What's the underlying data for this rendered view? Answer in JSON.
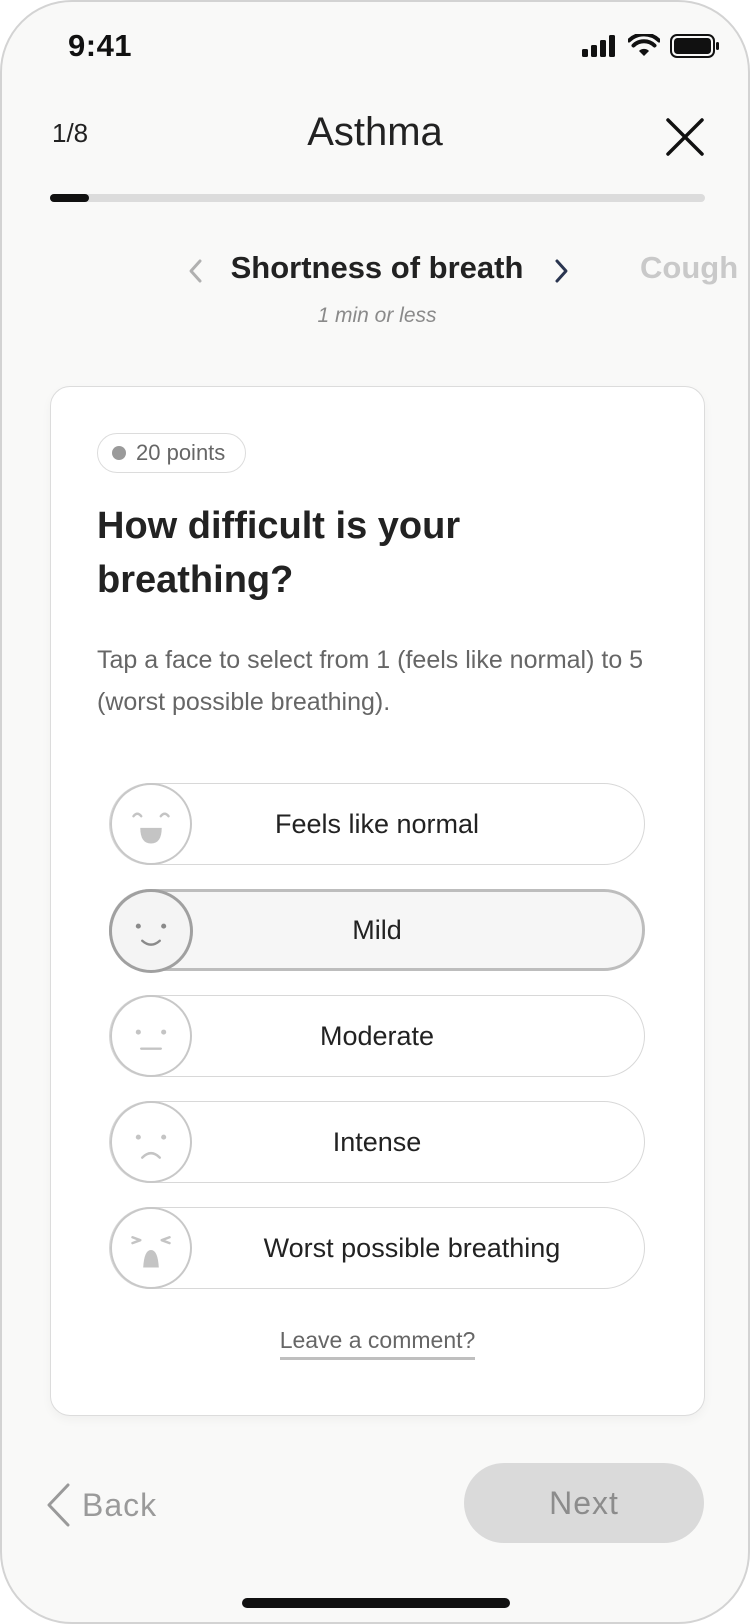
{
  "status_bar": {
    "time": "9:41"
  },
  "header": {
    "step": "1/8",
    "title": "Asthma"
  },
  "progress": {
    "fraction": 0.06
  },
  "carousel": {
    "current": "Shortness of breath",
    "next": "Cough",
    "duration": "1 min or less"
  },
  "card": {
    "points": "20 points",
    "question": "How difficult is your breathing?",
    "instructions": "Tap a face to select from 1 (feels like normal) to 5 (worst possible breathing).",
    "options": [
      {
        "label": "Feels like normal",
        "face": "smile-face-icon"
      },
      {
        "label": "Mild",
        "face": "slight-smile-face-icon",
        "selected": true
      },
      {
        "label": "Moderate",
        "face": "neutral-face-icon"
      },
      {
        "label": "Intense",
        "face": "frown-face-icon"
      },
      {
        "label": "Worst possible breathing",
        "face": "distressed-face-icon"
      }
    ],
    "comment_link": "Leave a comment?"
  },
  "footer": {
    "back_label": "Back",
    "next_label": "Next"
  },
  "colors": {
    "accent": "#111111",
    "track": "#dcdcdc",
    "muted": "#9a9a9a",
    "next_button_bg": "#dadada"
  }
}
